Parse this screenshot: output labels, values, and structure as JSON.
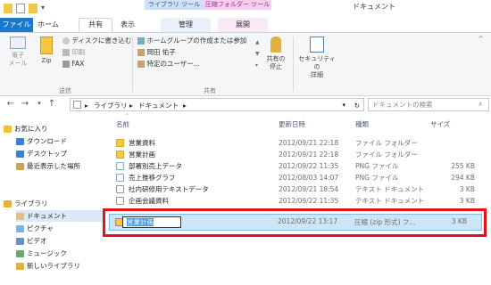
{
  "window": {
    "title": "ドキュメント",
    "context_tabs": {
      "library_tools": "ライブラリ ツール",
      "zip_tools": "圧縮フォルダー ツール"
    }
  },
  "tabs": {
    "file": "ファイル",
    "home": "ホーム",
    "share": "共有",
    "view": "表示",
    "manage": "管理",
    "expand": "展開"
  },
  "ribbon": {
    "email": "電子\nメール",
    "zip": "Zip",
    "burn": "ディスクに書き込む",
    "print": "印刷",
    "fax": "FAX",
    "send_group": "送信",
    "share_items": [
      "ホームグループの作成または参加",
      "岡田 佑子",
      "特定のユーザー..."
    ],
    "share_group": "共有",
    "stop_sharing": "共有の\n停止",
    "security": "セキュリティの\n詳細"
  },
  "address": {
    "breadcrumbs": [
      "ライブラリ",
      "ドキュメント"
    ],
    "search_placeholder": "ドキュメントの検索"
  },
  "nav": {
    "items": [
      {
        "label": "お気に入り",
        "indent": 0,
        "color": "#f0c030"
      },
      {
        "label": "ダウンロード",
        "indent": 1,
        "color": "#3d7fd1"
      },
      {
        "label": "デスクトップ",
        "indent": 1,
        "color": "#3d7fd1"
      },
      {
        "label": "最近表示した場所",
        "indent": 1,
        "color": "#c9a45c"
      },
      {
        "label": "ライブラリ",
        "indent": 0,
        "color": "#e1b23c"
      },
      {
        "label": "ドキュメント",
        "indent": 1,
        "color": "#d8c28a",
        "selected": true
      },
      {
        "label": "ピクチャ",
        "indent": 1,
        "color": "#7fb0e0"
      },
      {
        "label": "ビデオ",
        "indent": 1,
        "color": "#6b8fbf"
      },
      {
        "label": "ミュージック",
        "indent": 1,
        "color": "#6fa66f"
      },
      {
        "label": "新しいライブラリ",
        "indent": 1,
        "color": "#e1b23c"
      }
    ]
  },
  "list": {
    "headers": {
      "name": "名前",
      "date": "更新日時",
      "type": "種類",
      "size": "サイズ"
    },
    "rows": [
      {
        "name": "営業資料",
        "date": "2012/09/21 22:18",
        "type": "ファイル フォルダー",
        "size": "",
        "icon": "folder"
      },
      {
        "name": "営業計画",
        "date": "2012/09/21 22:18",
        "type": "ファイル フォルダー",
        "size": "",
        "icon": "folder"
      },
      {
        "name": "部署別売上データ",
        "date": "2012/09/22 11:35",
        "type": "PNG ファイル",
        "size": "255 KB",
        "icon": "png"
      },
      {
        "name": "売上推移グラフ",
        "date": "2012/08/03 14:07",
        "type": "PNG ファイル",
        "size": "294 KB",
        "icon": "png"
      },
      {
        "name": "社内研修用テキストデータ",
        "date": "2012/09/21 18:54",
        "type": "テキスト ドキュメント",
        "size": "3 KB",
        "icon": "txt"
      },
      {
        "name": "企画会議資料",
        "date": "2012/09/22 11:35",
        "type": "テキスト ドキュメント",
        "size": "3 KB",
        "icon": "txt"
      }
    ],
    "selected": {
      "name": "営業計画",
      "date": "2012/09/22 13:17",
      "type": "圧縮 (zip 形式) フ...",
      "size": "3 KB",
      "icon": "zip"
    }
  }
}
